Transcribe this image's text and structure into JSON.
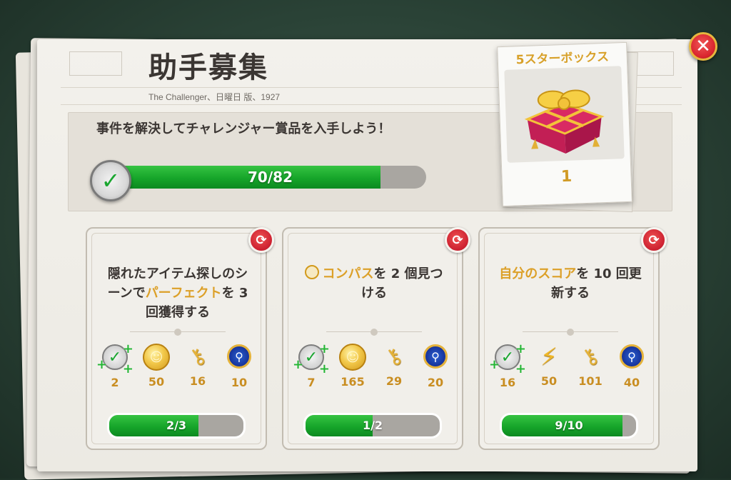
{
  "header": {
    "title": "助手募集",
    "subtitle": "The Challenger、日曜日 版、1927"
  },
  "main_task": {
    "text": "事件を解決してチャレンジャー賞品を入手しよう！",
    "progress_label": "70/82",
    "progress_fraction": 0.8537
  },
  "star_box": {
    "title": "5スターボックス",
    "count": "1"
  },
  "cards": [
    {
      "text_parts": [
        "隠れたアイテム探しのシーンで",
        "パーフェクト",
        "を 3 回獲得する"
      ],
      "rewards": [
        {
          "icon": "checkmark-badge-icon",
          "value": "2"
        },
        {
          "icon": "coin-icon",
          "value": "50"
        },
        {
          "icon": "key-icon",
          "value": "16"
        },
        {
          "icon": "magnifier-badge-icon",
          "value": "10"
        }
      ],
      "progress_label": "2/3",
      "progress_fraction": 0.6667
    },
    {
      "text_parts": [
        "コンパス",
        "を 2 個見つける"
      ],
      "rewards": [
        {
          "icon": "checkmark-badge-icon",
          "value": "7"
        },
        {
          "icon": "coin-icon",
          "value": "165"
        },
        {
          "icon": "key-icon",
          "value": "29"
        },
        {
          "icon": "magnifier-badge-icon",
          "value": "20"
        }
      ],
      "progress_label": "1/2",
      "progress_fraction": 0.5
    },
    {
      "text_parts": [
        "自分のスコア",
        "を 10 回更新する"
      ],
      "rewards": [
        {
          "icon": "checkmark-badge-icon",
          "value": "16"
        },
        {
          "icon": "lightning-bolt-icon",
          "value": "50"
        },
        {
          "icon": "key-icon",
          "value": "101"
        },
        {
          "icon": "magnifier-badge-icon",
          "value": "40"
        }
      ],
      "progress_label": "9/10",
      "progress_fraction": 0.9
    }
  ],
  "colors": {
    "progress_green": "#16a52a",
    "highlight_gold": "#dca028",
    "close_red": "#d9252e"
  }
}
